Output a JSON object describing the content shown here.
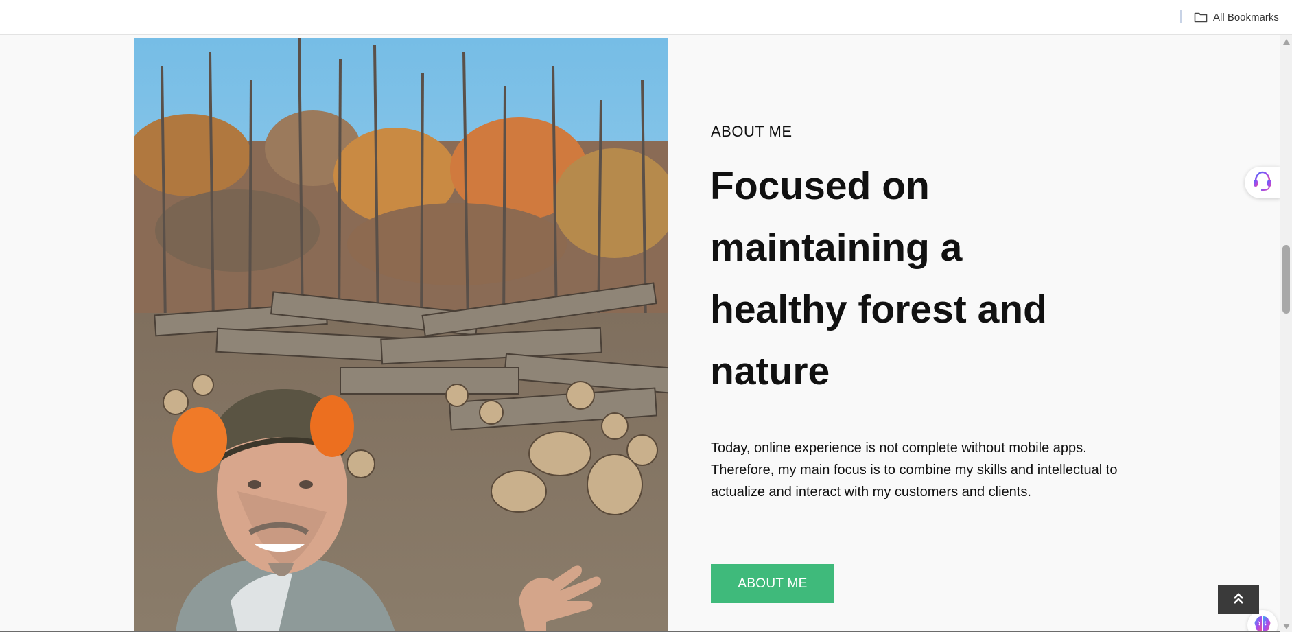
{
  "bookmarks_bar": {
    "all_bookmarks_label": "All Bookmarks"
  },
  "about": {
    "eyebrow": "ABOUT ME",
    "headline_lines": [
      "Focused on",
      "maintaining a",
      "healthy forest and",
      "nature"
    ],
    "paragraph": "Today, online experience is not complete without mobile apps. Therefore, my main focus is to combine my skills and intellectual to actualize and interact with my customers and clients.",
    "button_label": "ABOUT ME"
  },
  "colors": {
    "accent_green": "#3fba7b",
    "page_background": "#f9f9f9",
    "back_to_top_bg": "#3a3a3a"
  },
  "icons": {
    "folder": "folder-icon",
    "support": "headset-icon",
    "assistant": "brain-icon",
    "back_to_top": "double-chevron-up-icon"
  }
}
